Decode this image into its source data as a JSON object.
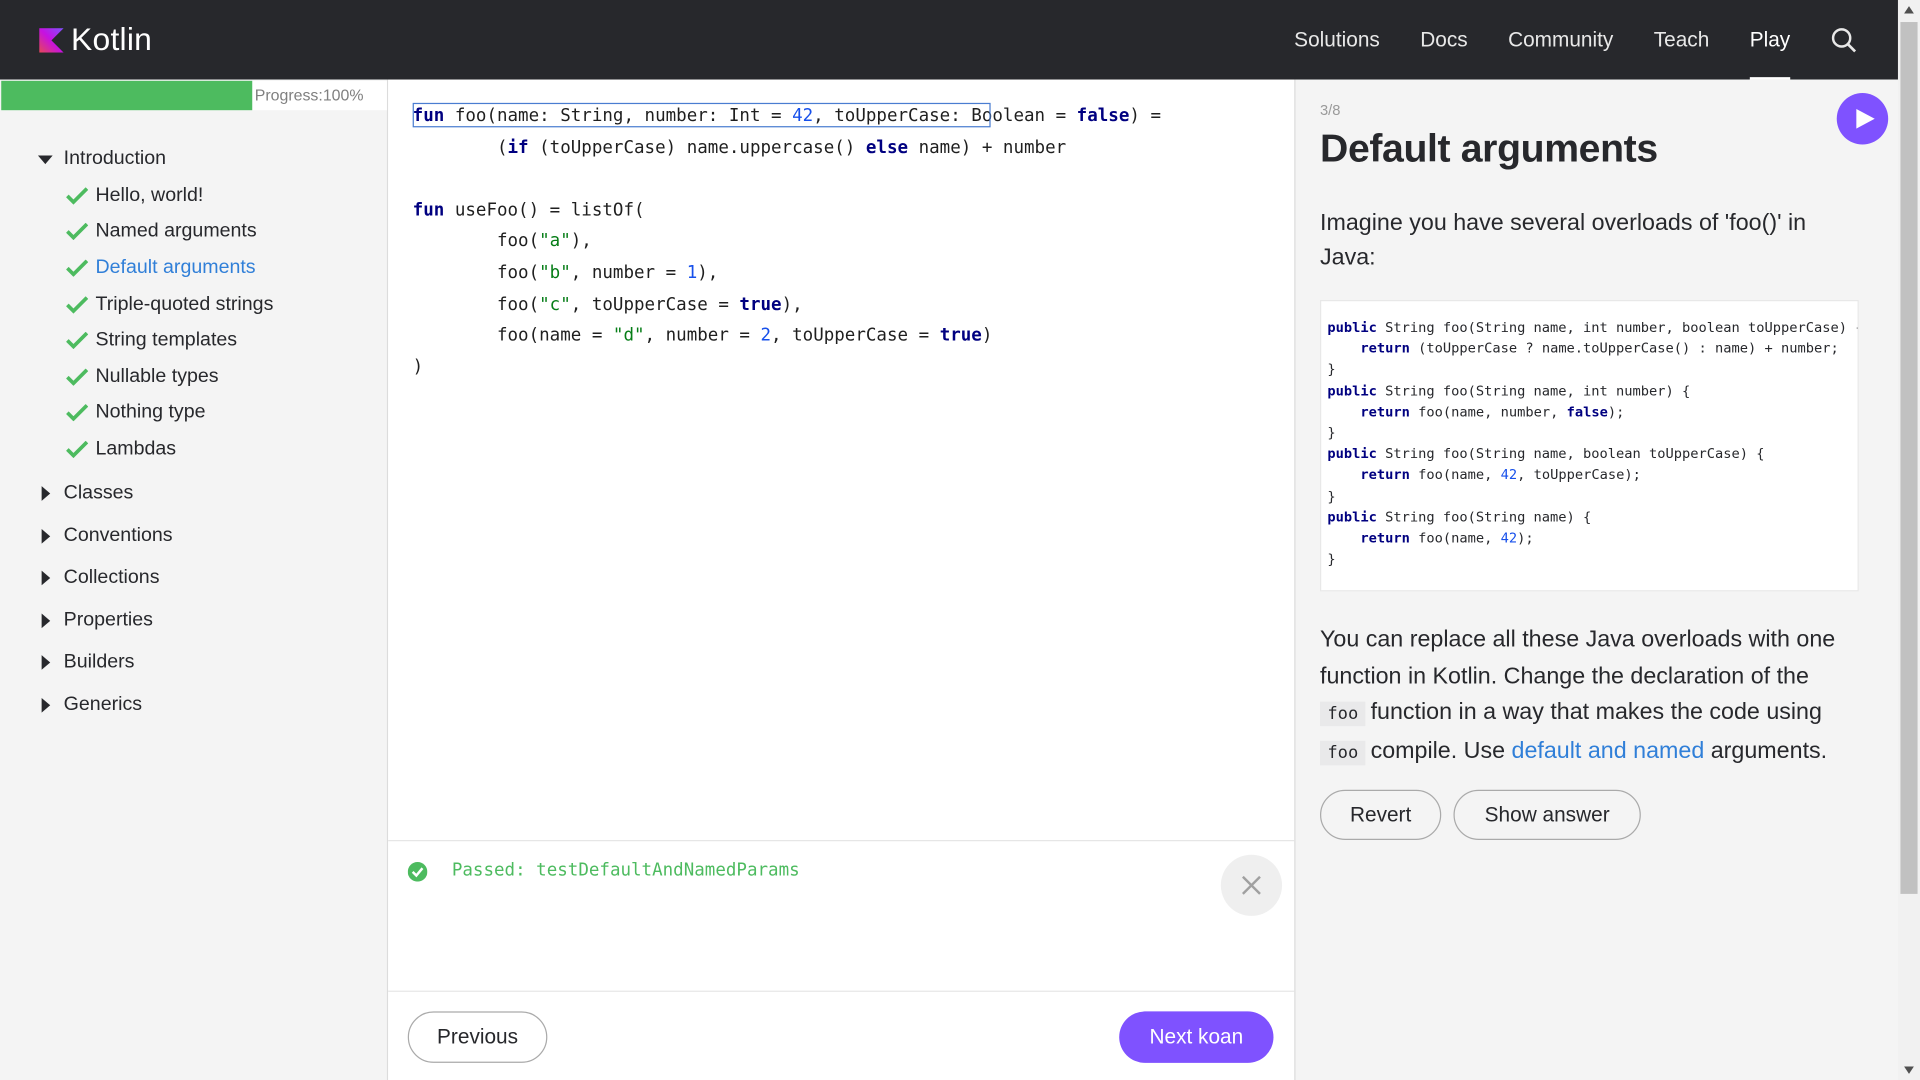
{
  "header": {
    "logo_text": "Kotlin",
    "nav": [
      "Solutions",
      "Docs",
      "Community",
      "Teach",
      "Play"
    ],
    "active_nav": "Play"
  },
  "sidebar": {
    "progress_label": "Progress:100%",
    "progress_value": 0.65,
    "sections": [
      {
        "label": "Introduction",
        "expanded": true,
        "items": [
          {
            "label": "Hello, world!",
            "done": true
          },
          {
            "label": "Named arguments",
            "done": true
          },
          {
            "label": "Default arguments",
            "done": true,
            "active": true
          },
          {
            "label": "Triple-quoted strings",
            "done": true
          },
          {
            "label": "String templates",
            "done": true
          },
          {
            "label": "Nullable types",
            "done": true
          },
          {
            "label": "Nothing type",
            "done": true
          },
          {
            "label": "Lambdas",
            "done": true
          }
        ]
      },
      {
        "label": "Classes",
        "expanded": false
      },
      {
        "label": "Conventions",
        "expanded": false
      },
      {
        "label": "Collections",
        "expanded": false
      },
      {
        "label": "Properties",
        "expanded": false
      },
      {
        "label": "Builders",
        "expanded": false
      },
      {
        "label": "Generics",
        "expanded": false
      }
    ]
  },
  "editor": {
    "code_lines": [
      "fun foo(name: String, number: Int = 42, toUpperCase: Boolean = false) =",
      "        (if (toUpperCase) name.uppercase() else name) + number",
      "",
      "fun useFoo() = listOf(",
      "        foo(\"a\"),",
      "        foo(\"b\", number = 1),",
      "        foo(\"c\", toUpperCase = true),",
      "        foo(name = \"d\", number = 2, toUpperCase = true)",
      ")"
    ]
  },
  "output": {
    "status": "Passed: testDefaultAndNamedParams"
  },
  "footer": {
    "previous_label": "Previous",
    "next_label": "Next koan"
  },
  "panel": {
    "step": "3/8",
    "title": "Default arguments",
    "intro": "Imagine you have several overloads of 'foo()' in Java:",
    "java_lines": [
      "public String foo(String name, int number, boolean toUpperCase) {",
      "    return (toUpperCase ? name.toUpperCase() : name) + number;",
      "}",
      "public String foo(String name, int number) {",
      "    return foo(name, number, false);",
      "}",
      "public String foo(String name, boolean toUpperCase) {",
      "    return foo(name, 42, toUpperCase);",
      "}",
      "public String foo(String name) {",
      "    return foo(name, 42);",
      "}"
    ],
    "desc_part1": "You can replace all these Java overloads with one function in Kotlin. Change the declaration of the",
    "code_word1": "foo",
    "desc_part2": "function in a way that makes the code using",
    "code_word2": "foo",
    "desc_part3": "compile. Use",
    "link_text": "default and named",
    "desc_part4": "arguments.",
    "revert_label": "Revert",
    "answer_label": "Show answer"
  },
  "colors": {
    "header_bg": "#27282c",
    "accent": "#7f52ff",
    "progress": "#4dbb5f",
    "link": "#307fd8"
  }
}
